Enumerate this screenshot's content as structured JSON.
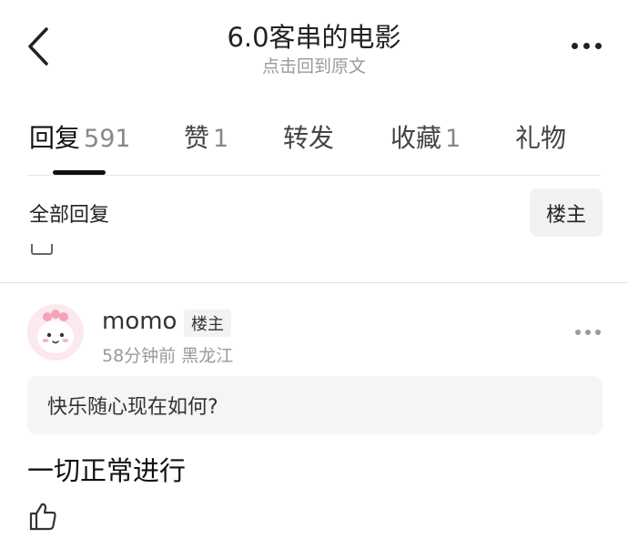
{
  "header": {
    "title": "6.0客串的电影",
    "subtitle": "点击回到原文",
    "back_icon": "chevron-left-icon",
    "more_icon": "more-horizontal-icon"
  },
  "tabs": [
    {
      "label": "回复",
      "count": "591",
      "active": true
    },
    {
      "label": "赞",
      "count": "1",
      "active": false
    },
    {
      "label": "转发",
      "count": "",
      "active": false
    },
    {
      "label": "收藏",
      "count": "1",
      "active": false
    },
    {
      "label": "礼物",
      "count": "",
      "active": false
    }
  ],
  "filter": {
    "all_replies_label": "全部回复",
    "op_only_label": "楼主"
  },
  "comment": {
    "username": "momo",
    "badge": "楼主",
    "time": "58分钟前",
    "location": "黑龙江",
    "quote_author": "快乐随心",
    "quote_text": "现在如何?",
    "text": "一切正常进行",
    "like_icon": "thumbs-up-icon"
  },
  "colors": {
    "primary_text": "#222222",
    "secondary_text": "#9a9a9a",
    "quote_bg": "#f5f5f5",
    "badge_bg": "#f2f2f2"
  }
}
